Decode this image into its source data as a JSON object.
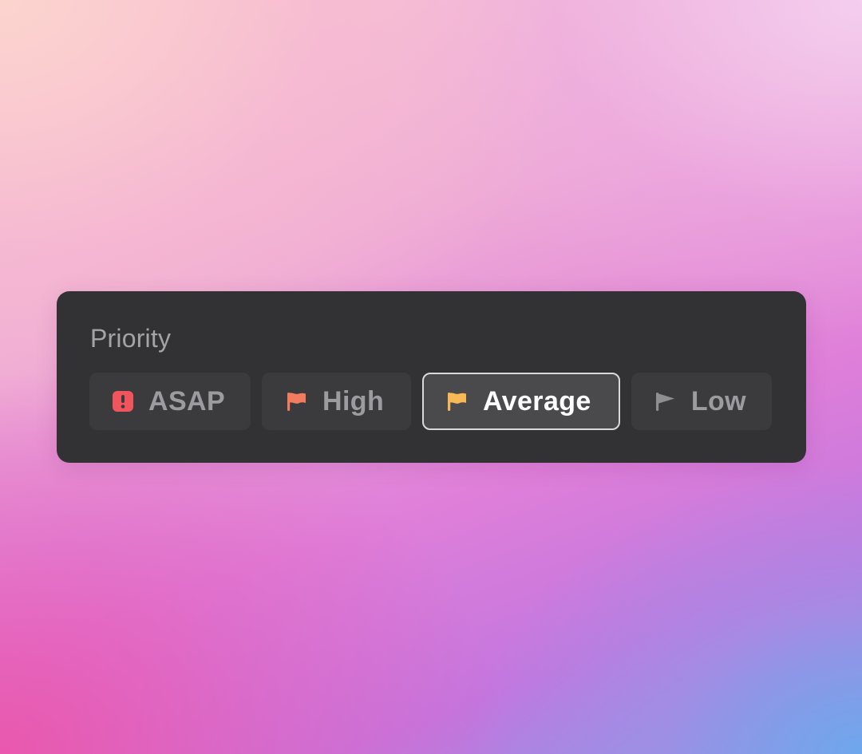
{
  "panel": {
    "title": "Priority",
    "options": [
      {
        "label": "ASAP",
        "icon": "exclamation-badge-icon",
        "icon_color": "#F2545B",
        "selected": false
      },
      {
        "label": "High",
        "icon": "flag-icon",
        "icon_color": "#F37B5E",
        "selected": false
      },
      {
        "label": "Average",
        "icon": "flag-icon",
        "icon_color": "#F7B955",
        "selected": true
      },
      {
        "label": "Low",
        "icon": "flag-icon",
        "icon_color": "#8E8E93",
        "selected": false
      }
    ]
  },
  "colors": {
    "panel_background": "#323234",
    "option_background": "#3B3B3E",
    "selected_border": "#D9D9DC",
    "text_muted": "#9B9BA0",
    "text_selected": "#FFFFFF"
  }
}
